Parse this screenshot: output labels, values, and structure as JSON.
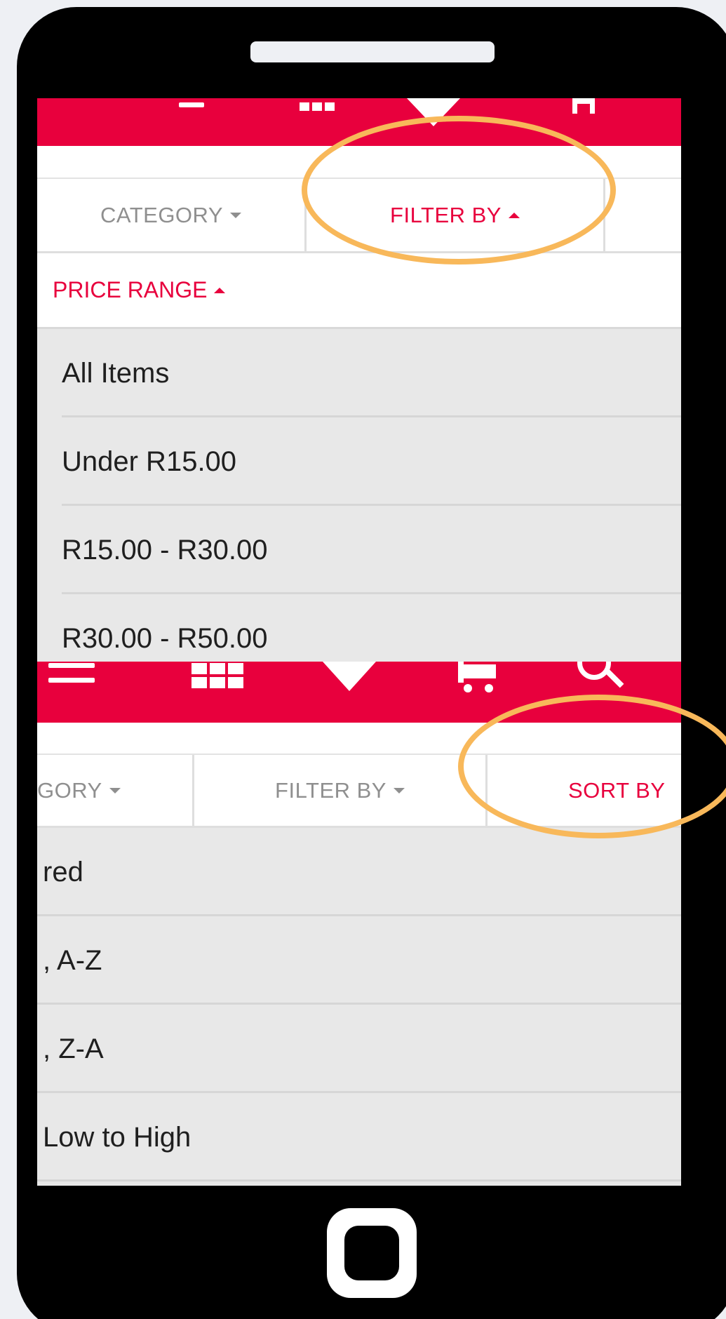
{
  "filter_screen": {
    "tabs": [
      {
        "label": "CATEGORY",
        "active": false
      },
      {
        "label": "FILTER BY",
        "active": true
      }
    ],
    "subheader": "PRICE RANGE",
    "price_options": [
      "All Items",
      "Under R15.00",
      "R15.00 - R30.00",
      "R30.00 - R50.00"
    ]
  },
  "sort_screen": {
    "tabs": [
      {
        "label": "GORY",
        "active": false
      },
      {
        "label": "FILTER BY",
        "active": false
      },
      {
        "label": "SORT BY",
        "active": true
      }
    ],
    "sort_options": [
      "red",
      ", A-Z",
      ", Z-A",
      "Low to High"
    ]
  },
  "icons": {
    "nav": [
      "menu-icon",
      "grid-icon",
      "heart-icon",
      "cart-icon",
      "search-icon"
    ]
  },
  "colors": {
    "accent": "#e8003d",
    "highlight_ring": "#f8b85a",
    "phone_frame": "#000000",
    "background": "#eef0f4",
    "list_bg": "#e8e8e8"
  }
}
